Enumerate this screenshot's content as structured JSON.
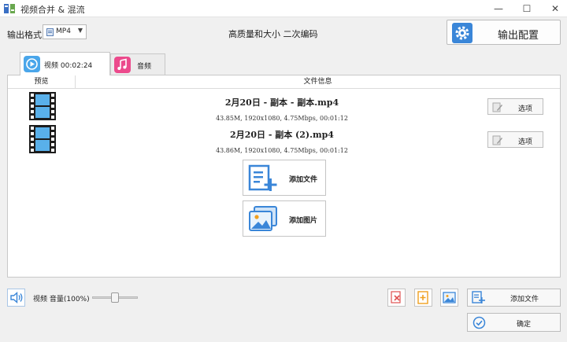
{
  "window": {
    "title": "视频合并 & 混流",
    "minimize": "—",
    "maximize": "☐",
    "close": "✕"
  },
  "toolbar": {
    "format_label": "输出格式",
    "format_value": "MP4",
    "quality_text": "高质量和大小  二次编码",
    "config_button": "输出配置"
  },
  "tabs": [
    {
      "label": "视频 00:02:24",
      "icon": "video-play-icon",
      "color": "#4aa6ea"
    },
    {
      "label": "音频",
      "icon": "music-note-icon",
      "color": "#ec4a8c"
    }
  ],
  "columns": {
    "preview": "预览",
    "info": "文件信息"
  },
  "files": [
    {
      "name": "2月20日 - 副本 - 副本.mp4",
      "meta": "43.85M, 1920x1080, 4.75Mbps, 00:01:12",
      "option_label": "选项"
    },
    {
      "name": "2月20日 - 副本 (2).mp4",
      "meta": "43.86M, 1920x1080, 4.75Mbps, 00:01:12",
      "option_label": "选项"
    }
  ],
  "actions": {
    "add_file": "添加文件",
    "add_image": "添加图片"
  },
  "bottom": {
    "volume_label": "视频 音量(100%)",
    "volume_level": 0.5,
    "add_file_button": "添加文件",
    "ok_button": "确定"
  },
  "colors": {
    "accent_blue": "#3a86d8",
    "tab_audio": "#ec4a8c",
    "delete_red": "#e05050",
    "folder_orange": "#f0a020"
  }
}
